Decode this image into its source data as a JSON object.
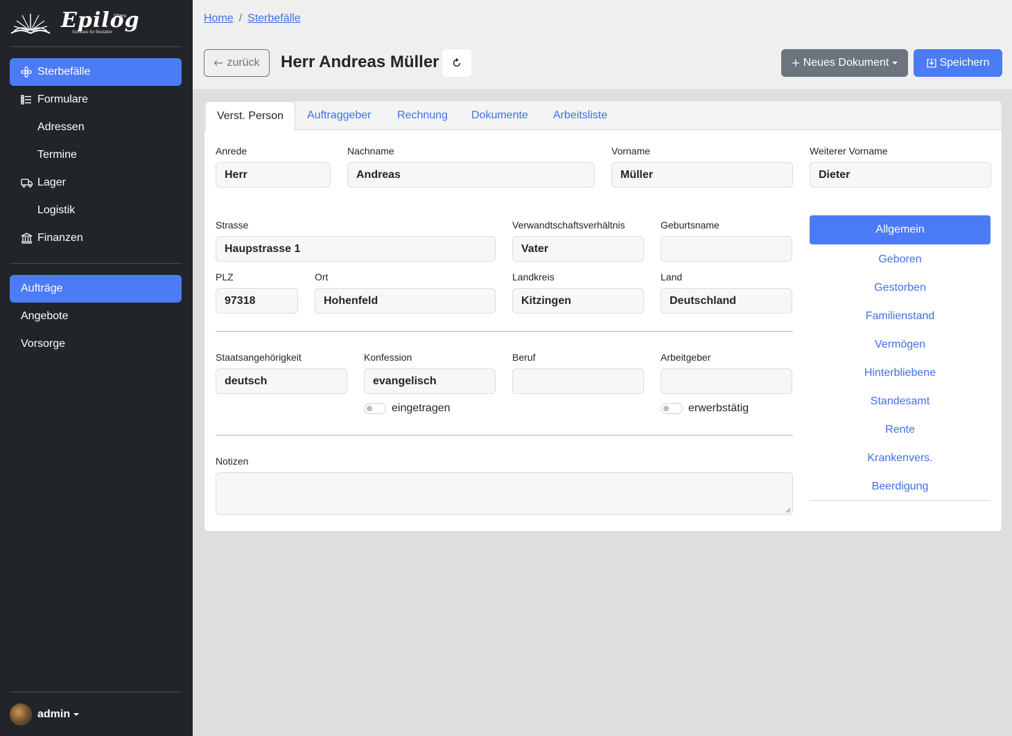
{
  "brand": {
    "name": "Epilog",
    "maker": "Vitaro",
    "tagline": "Software für Bestatter"
  },
  "sidebar": {
    "items": [
      {
        "label": "Sterbefälle",
        "icon": "flower-icon",
        "active": true
      },
      {
        "label": "Formulare",
        "icon": "list-icon"
      },
      {
        "label": "Adressen"
      },
      {
        "label": "Termine"
      },
      {
        "label": "Lager",
        "icon": "truck-icon"
      },
      {
        "label": "Logistik"
      },
      {
        "label": "Finanzen",
        "icon": "bank-icon"
      }
    ],
    "secondary": [
      {
        "label": "Aufträge",
        "active": true
      },
      {
        "label": "Angebote"
      },
      {
        "label": "Vorsorge"
      }
    ],
    "user": "admin"
  },
  "breadcrumb": {
    "home": "Home",
    "current": "Sterbefälle"
  },
  "header": {
    "back_label": "zurück",
    "title": "Herr Andreas Müller",
    "new_doc_label": "Neues Dokument",
    "save_label": "Speichern"
  },
  "tabs": [
    "Verst. Person",
    "Auftraggeber",
    "Rechnung",
    "Dokumente",
    "Arbeitsliste"
  ],
  "form": {
    "anrede": {
      "label": "Anrede",
      "value": "Herr"
    },
    "nachname": {
      "label": "Nachname",
      "value": "Andreas"
    },
    "vorname": {
      "label": "Vorname",
      "value": "Müller"
    },
    "weiterer_vorname": {
      "label": "Weiterer Vorname",
      "value": "Dieter"
    },
    "strasse": {
      "label": "Strasse",
      "value": "Haupstrasse 1"
    },
    "verwandtschaft": {
      "label": "Verwandtschaftsverhältnis",
      "value": "Vater"
    },
    "geburtsname": {
      "label": "Geburtsname",
      "value": ""
    },
    "plz": {
      "label": "PLZ",
      "value": "97318"
    },
    "ort": {
      "label": "Ort",
      "value": "Hohenfeld"
    },
    "landkreis": {
      "label": "Landkreis",
      "value": "Kitzingen"
    },
    "land": {
      "label": "Land",
      "value": "Deutschland"
    },
    "staatsangehoerigkeit": {
      "label": "Staatsangehörigkeit",
      "value": "deutsch"
    },
    "konfession": {
      "label": "Konfession",
      "value": "evangelisch"
    },
    "beruf": {
      "label": "Beruf",
      "value": ""
    },
    "arbeitgeber": {
      "label": "Arbeitgeber",
      "value": ""
    },
    "eingetragen": {
      "label": "eingetragen",
      "checked": false
    },
    "erwerbstaetig": {
      "label": "erwerbstätig",
      "checked": false
    },
    "notizen": {
      "label": "Notizen",
      "value": ""
    }
  },
  "subnav": [
    "Allgemein",
    "Geboren",
    "Gestorben",
    "Familienstand",
    "Vermögen",
    "Hinterbliebene",
    "Standesamt",
    "Rente",
    "Krankenvers.",
    "Beerdigung"
  ],
  "colors": {
    "primary": "#4b7bf5",
    "sidebar": "#212429",
    "secondary": "#6c757d",
    "link": "#3f6fe8"
  }
}
